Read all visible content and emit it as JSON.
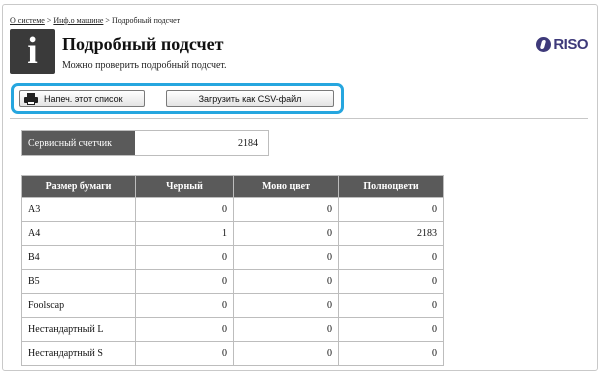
{
  "breadcrumb": {
    "items": [
      "О системе",
      "Инф.о машине",
      "Подробный подсчет"
    ],
    "separator": ">"
  },
  "header": {
    "icon": "info-icon",
    "icon_glyph": "i",
    "title": "Подробный подсчет",
    "subtitle": "Можно проверить подробный подсчет.",
    "logo_text": "RISO"
  },
  "toolbar": {
    "print_label": "Напеч. этот список",
    "print_icon": "printer-icon",
    "csv_label": "Загрузить как CSV-файл",
    "highlight_color": "#26a6df"
  },
  "service_counter": {
    "label": "Сервисный счетчик",
    "value": "2184"
  },
  "table": {
    "headers": [
      "Размер бумаги",
      "Черный",
      "Моно цвет",
      "Полноцвети"
    ],
    "rows": [
      [
        "A3",
        "0",
        "0",
        "0"
      ],
      [
        "A4",
        "1",
        "0",
        "2183"
      ],
      [
        "B4",
        "0",
        "0",
        "0"
      ],
      [
        "B5",
        "0",
        "0",
        "0"
      ],
      [
        "Foolscap",
        "0",
        "0",
        "0"
      ],
      [
        "Нестандартный L",
        "0",
        "0",
        "0"
      ],
      [
        "Нестандартный S",
        "0",
        "0",
        "0"
      ]
    ]
  },
  "colors": {
    "header_bg": "#5a5a5a",
    "logo": "#3e3a7a",
    "highlight": "#26a6df"
  }
}
